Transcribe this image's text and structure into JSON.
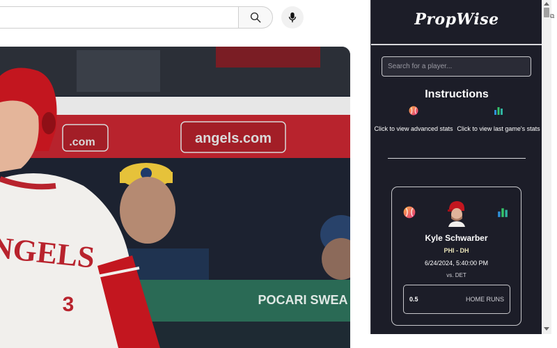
{
  "youtube": {
    "search_value": "",
    "search_icon": "search-icon",
    "mic_icon": "mic-icon"
  },
  "video": {
    "scene": "baseball-broadcast"
  },
  "panel": {
    "logo": "PropWise",
    "search_placeholder": "Search for a player...",
    "instructions_title": "Instructions",
    "instructions": [
      {
        "icon": "baseball-icon",
        "text": "Click to view advanced stats"
      },
      {
        "icon": "bar-chart-icon",
        "text": "Click to view last game's stats"
      }
    ],
    "player": {
      "name": "Kyle Schwarber",
      "team_pos": "PHI - DH",
      "datetime": "6/24/2024, 5:40:00 PM",
      "opponent": "vs. DET",
      "prop_line": "0.5",
      "prop_stat": "HOME RUNS"
    }
  },
  "colors": {
    "panel_bg": "#1c1d28",
    "team_text": "#e9e3b8",
    "angels_red": "#c8102e"
  }
}
